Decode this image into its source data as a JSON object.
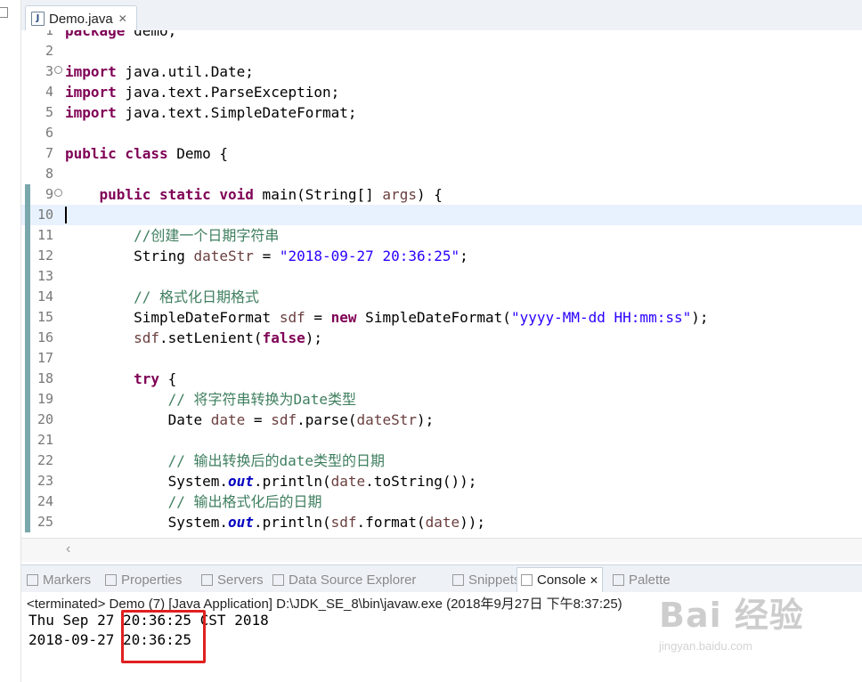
{
  "editor_tab": {
    "title": "Demo.java",
    "icon": "java-file-icon",
    "close": "✕"
  },
  "code_lines": [
    {
      "n": "1",
      "html": "<span class=\"kw\">package</span> demo;"
    },
    {
      "n": "2",
      "html": ""
    },
    {
      "n": "3",
      "html": "<span class=\"kw\">import</span> java.util.Date;",
      "fold": true
    },
    {
      "n": "4",
      "html": "<span class=\"kw\">import</span> java.text.ParseException;"
    },
    {
      "n": "5",
      "html": "<span class=\"kw\">import</span> java.text.SimpleDateFormat;"
    },
    {
      "n": "6",
      "html": ""
    },
    {
      "n": "7",
      "html": "<span class=\"kw\">public class</span> Demo {"
    },
    {
      "n": "8",
      "html": ""
    },
    {
      "n": "9",
      "html": "    <span class=\"kw\">public static void</span> main(String[] <span class=\"var\">args</span>) {",
      "fold": true,
      "mark": true
    },
    {
      "n": "10",
      "html": "",
      "current": true,
      "mark": true
    },
    {
      "n": "11",
      "html": "        <span class=\"cm\">//创建一个日期字符串</span>",
      "mark": true
    },
    {
      "n": "12",
      "html": "        String <span class=\"var\">dateStr</span> = <span class=\"str\">\"2018-09-27 20:36:25\"</span>;",
      "mark": true
    },
    {
      "n": "13",
      "html": "",
      "mark": true
    },
    {
      "n": "14",
      "html": "        <span class=\"cm\">// 格式化日期格式</span>",
      "mark": true
    },
    {
      "n": "15",
      "html": "        SimpleDateFormat <span class=\"var\">sdf</span> = <span class=\"kw\">new</span> SimpleDateFormat(<span class=\"str\">\"yyyy-MM-dd HH:mm:ss\"</span>);",
      "mark": true
    },
    {
      "n": "16",
      "html": "        <span class=\"var\">sdf</span>.setLenient(<span class=\"kw\">false</span>);",
      "mark": true
    },
    {
      "n": "17",
      "html": "",
      "mark": true
    },
    {
      "n": "18",
      "html": "        <span class=\"kw\">try</span> {",
      "mark": true
    },
    {
      "n": "19",
      "html": "            <span class=\"cm\">// 将字符串转换为Date类型</span>",
      "mark": true
    },
    {
      "n": "20",
      "html": "            Date <span class=\"var\">date</span> = <span class=\"var\">sdf</span>.parse(<span class=\"var\">dateStr</span>);",
      "mark": true
    },
    {
      "n": "21",
      "html": "",
      "mark": true
    },
    {
      "n": "22",
      "html": "            <span class=\"cm\">// 输出转换后的date类型的日期</span>",
      "mark": true
    },
    {
      "n": "23",
      "html": "            System.<span class=\"fld\">out</span>.println(<span class=\"var\">date</span>.toString());",
      "mark": true
    },
    {
      "n": "24",
      "html": "            <span class=\"cm\">// 输出格式化后的日期</span>",
      "mark": true
    },
    {
      "n": "25",
      "html": "            System.<span class=\"fld\">out</span>.println(<span class=\"var\">sdf</span>.format(<span class=\"var\">date</span>));",
      "mark": true
    }
  ],
  "view_tabs": [
    {
      "label": "Markers",
      "icon": "markers-icon",
      "active": false
    },
    {
      "label": "Properties",
      "icon": "properties-icon",
      "active": false
    },
    {
      "label": "Servers",
      "icon": "servers-icon",
      "active": false
    },
    {
      "label": "Data Source Explorer",
      "icon": "data-source-icon",
      "active": false
    },
    {
      "label": "Snippets",
      "icon": "snippets-icon",
      "active": false
    },
    {
      "label": "Console",
      "icon": "console-icon",
      "active": true,
      "close": "✕"
    },
    {
      "label": "Palette",
      "icon": "palette-icon",
      "active": false
    }
  ],
  "console": {
    "status": "<terminated> Demo (7) [Java Application] D:\\JDK_SE_8\\bin\\javaw.exe (2018年9月27日 下午8:37:25)",
    "lines": [
      "Thu Sep 27 20:36:25 CST 2018",
      "2018-09-27 20:36:25"
    ]
  },
  "watermark": {
    "text": "Bai 经验",
    "sub": "jingyan.baidu.com"
  }
}
